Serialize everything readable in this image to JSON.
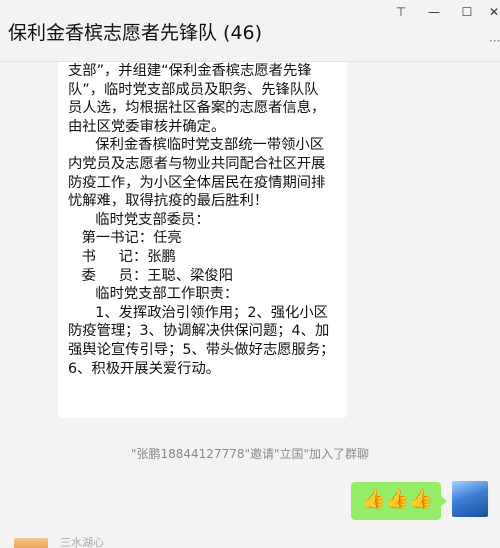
{
  "window": {
    "title": "保利金香槟志愿者先锋队 (46)",
    "controls": {
      "pin_icon": "pin-icon",
      "minimize_icon": "minimize-icon",
      "maximize_icon": "maximize-icon",
      "close_icon": "close-icon",
      "pin_glyph": "⊤",
      "minimize_glyph": "—",
      "maximize_glyph": "☐",
      "close_glyph": "✕"
    }
  },
  "messages": {
    "announcement_lines": [
      "支部”，并组建“保利金香槟志愿者先锋",
      "队”，临时党支部成员及职务、先锋队队",
      "员人选，均根据社区备案的志愿者信息，",
      "由社区党委审核并确定。",
      "      保利金香槟临时党支部统一带领小区",
      "内党员及志愿者与物业共同配合社区开展",
      "防疫工作，为小区全体居民在疫情期间排",
      "忧解难，取得抗疫的最后胜利！",
      "      临时党支部委员：",
      "   第一书记：任亮",
      "   书     记：张鹏",
      "   委     员：王聪、梁俊阳",
      "      临时党支部工作职责：",
      "      1、发挥政治引领作用；2、强化小区",
      "防疫管理；3、协调解决供保问题；4、加",
      "强舆论宣传引导；5、带头做好志愿服务；",
      "6、积极开展关爱行动。"
    ],
    "system_notice": "\"张鹏18844127778\"邀请\"立国\"加入了群聊",
    "my_message": "👍👍👍",
    "next_sender_partial": "三水湖心"
  },
  "colors": {
    "chat_bg": "#f3f3f3",
    "my_bubble": "#95ec69",
    "their_bubble": "#ffffff",
    "system_text": "#8a8a8a"
  }
}
